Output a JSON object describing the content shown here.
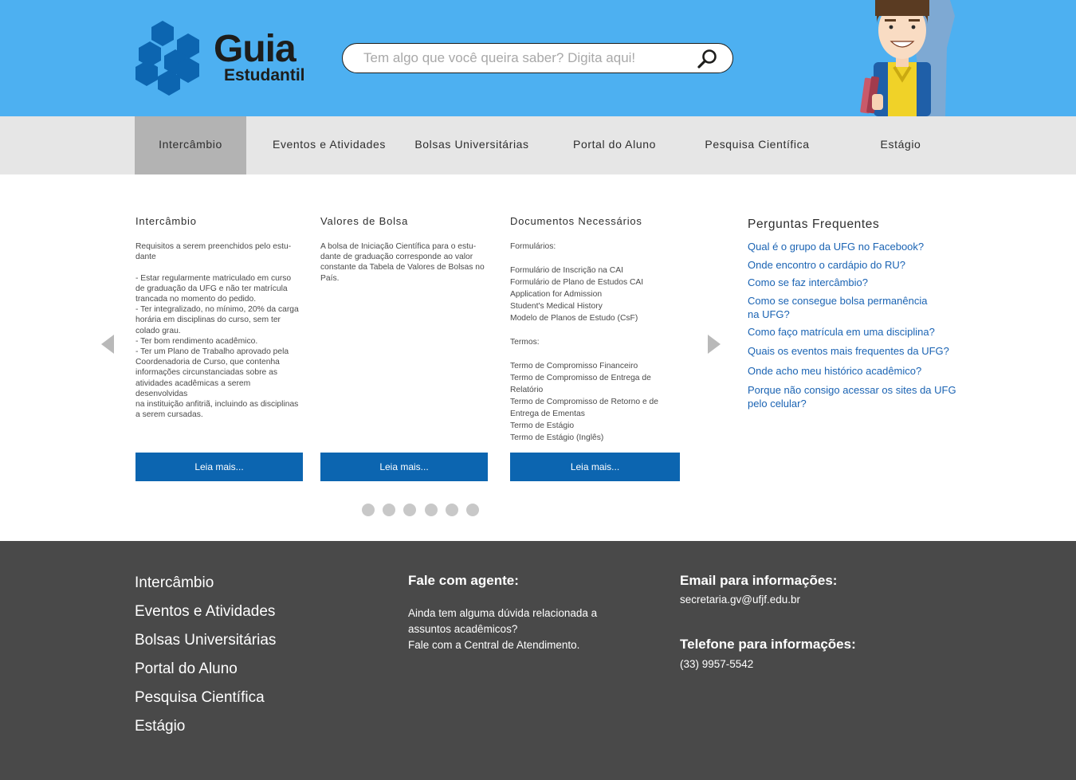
{
  "colors": {
    "header_bg": "#4db0f1",
    "accent_blue": "#0c65b0",
    "link_blue": "#1a63b3",
    "footer_bg": "#494949",
    "nav_bg": "#e6e6e6",
    "nav_active": "#b3b3b3"
  },
  "logo": {
    "title": "Guia",
    "subtitle": "Estudantil",
    "icon": "hexagon-cluster-icon"
  },
  "search": {
    "placeholder": "Tem algo que você queira saber? Digita aqui!",
    "value": "",
    "icon": "search-icon"
  },
  "nav": {
    "items": [
      {
        "label": "Intercâmbio",
        "active": true
      },
      {
        "label": "Eventos e Atividades"
      },
      {
        "label": "Bolsas Universitárias"
      },
      {
        "label": "Portal do Aluno"
      },
      {
        "label": "Pesquisa Científica"
      },
      {
        "label": "Estágio"
      }
    ]
  },
  "carousel": {
    "cards": [
      {
        "title": "Intercâmbio",
        "lines": [
          "Requisitos a serem preenchidos pelo estu-",
          "dante",
          "",
          " - Estar regularmente matriculado em curso",
          "de graduação da UFG e não ter matrícula",
          "trancada no momento do pedido.",
          " - Ter integralizado, no mínimo, 20% da carga",
          "horária em disciplinas do curso, sem ter",
          "colado grau.",
          " - Ter bom rendimento acadêmico.",
          " - Ter um Plano de Trabalho aprovado pela",
          "Coordenadoria de Curso, que contenha",
          "informações circunstanciadas sobre as",
          "atividades acadêmicas a serem desenvolvidas",
          "na instituição anfitriã, incluindo as disciplinas",
          "a serem cursadas."
        ],
        "button": "Leia mais..."
      },
      {
        "title": "Valores de Bolsa",
        "lines": [
          "A bolsa de Iniciação Científica para o estu-",
          "dante de graduação corresponde ao valor",
          "constante da Tabela de Valores de Bolsas no",
          "País."
        ],
        "button": "Leia mais..."
      },
      {
        "title": "Documentos Necessários",
        "lines": [
          "Formulários:",
          "",
          "Formulário de Inscrição na CAI",
          "Formulário de Plano de Estudos CAI",
          "Application for Admission",
          "Student's Medical History",
          "Modelo de Planos de Estudo (CsF)",
          "",
          "Termos:",
          "",
          "Termo de Compromisso Financeiro",
          "Termo de Compromisso de Entrega de",
          "Relatório",
          "Termo de Compromisso de Retorno e de",
          "Entrega de Ementas",
          "Termo de Estágio",
          "Termo de Estágio (Inglês)"
        ],
        "button": "Leia mais..."
      }
    ],
    "dots": {
      "count": 6,
      "active_index": 3
    },
    "prev_icon": "arrow-left-icon",
    "next_icon": "arrow-right-icon"
  },
  "faq": {
    "title": "Perguntas Frequentes",
    "items": [
      "Qual é o grupo da UFG no Facebook?",
      "Onde encontro o cardápio do RU?",
      "Como se faz intercâmbio?",
      "Como se consegue bolsa permanência na UFG?",
      "Como faço matrícula em uma disciplina?",
      "Quais os eventos mais frequentes da UFG?",
      "Onde acho meu histórico acadêmico?",
      "Porque não consigo acessar os sites da UFG pelo celular?"
    ]
  },
  "footer": {
    "links": [
      "Intercâmbio",
      "Eventos e Atividades",
      "Bolsas Universitárias",
      "Portal do Aluno",
      "Pesquisa Científica",
      "Estágio"
    ],
    "agent": {
      "heading": "Fale com agente:",
      "line1": "Ainda tem alguma dúvida relacionada a",
      "line2": "assuntos acadêmicos?",
      "line3": "Fale com a Central de Atendimento."
    },
    "email": {
      "heading": "Email para informações:",
      "value": "secretaria.gv@ufjf.edu.br"
    },
    "phone": {
      "heading": "Telefone para informações:",
      "value": "(33) 9957-5542"
    }
  }
}
